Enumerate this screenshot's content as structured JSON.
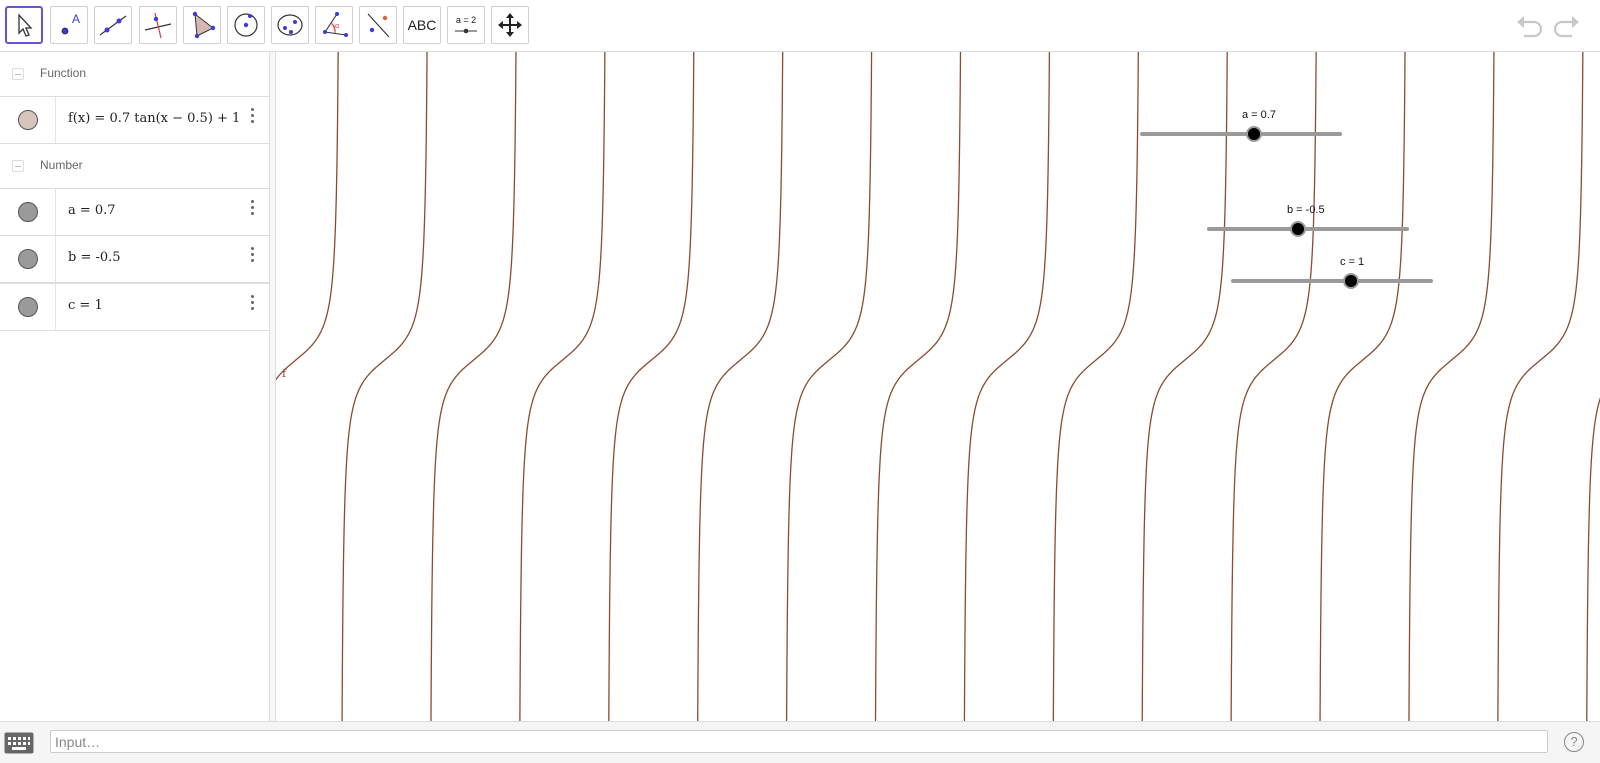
{
  "toolbar": {
    "tools": [
      {
        "name": "move-tool-button",
        "icon": "pointer-arrow-icon",
        "active": true
      },
      {
        "name": "point-tool-button",
        "icon": "point-icon",
        "label": "A"
      },
      {
        "name": "line-tool-button",
        "icon": "line-icon"
      },
      {
        "name": "perpendicular-tool-button",
        "icon": "perpendicular-line-icon"
      },
      {
        "name": "polygon-tool-button",
        "icon": "polygon-icon"
      },
      {
        "name": "circle-tool-button",
        "icon": "circle-center-point-icon"
      },
      {
        "name": "ellipse-tool-button",
        "icon": "ellipse-icon"
      },
      {
        "name": "angle-tool-button",
        "icon": "angle-icon"
      },
      {
        "name": "reflect-tool-button",
        "icon": "reflect-icon"
      },
      {
        "name": "text-tool-button",
        "icon": "text-icon",
        "label": "ABC"
      },
      {
        "name": "slider-tool-button",
        "icon": "slider-icon",
        "label": "a = 2"
      },
      {
        "name": "move-graphics-tool-button",
        "icon": "move-arrows-icon"
      }
    ],
    "undo_icon": "undo-icon",
    "redo_icon": "redo-icon"
  },
  "algebra": {
    "groups": [
      {
        "label": "Function",
        "items": [
          {
            "text": "f(x)  =  0.7  tan(x − 0.5) + 1",
            "color": "#d7c5bd"
          }
        ]
      },
      {
        "label": "Number",
        "items": [
          {
            "text": "a  =  0.7",
            "color": "#9a9a9a"
          },
          {
            "text": "b  =  -0.5",
            "color": "#9a9a9a"
          },
          {
            "text": "c  =  1",
            "color": "#9a9a9a"
          }
        ]
      }
    ]
  },
  "graphics": {
    "function_label": "f",
    "function_color": "#8a4b2e",
    "sliders": [
      {
        "label": "a = 0.7",
        "value": 0.7
      },
      {
        "label": "b = -0.5",
        "value": -0.5
      },
      {
        "label": "c = 1",
        "value": 1
      }
    ]
  },
  "input_bar": {
    "placeholder": "Input…",
    "keyboard_icon": "keyboard-icon",
    "help_icon": "help-icon",
    "help_text": "?"
  }
}
